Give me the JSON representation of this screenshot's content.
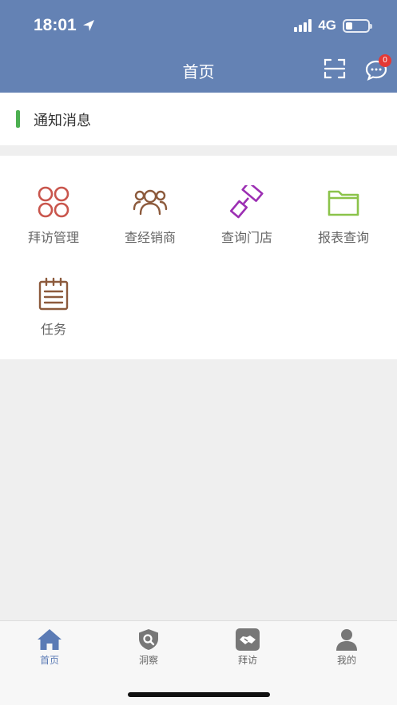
{
  "status_bar": {
    "time": "18:01",
    "network": "4G"
  },
  "header": {
    "title": "首页",
    "message_badge": "0"
  },
  "notice": {
    "label": "通知消息"
  },
  "menu": [
    {
      "label": "拜访管理",
      "icon": "four-circles-icon",
      "color": "#c9564d"
    },
    {
      "label": "查经销商",
      "icon": "people-group-icon",
      "color": "#8c5a3c"
    },
    {
      "label": "查询门店",
      "icon": "roller-brush-icon",
      "color": "#9c2fb3"
    },
    {
      "label": "报表查询",
      "icon": "folder-icon",
      "color": "#8bc34a"
    },
    {
      "label": "任务",
      "icon": "notepad-icon",
      "color": "#8c5a3c"
    }
  ],
  "tabs": [
    {
      "label": "首页",
      "icon": "home-icon",
      "active": true
    },
    {
      "label": "洞察",
      "icon": "shield-search-icon",
      "active": false
    },
    {
      "label": "拜访",
      "icon": "handshake-icon",
      "active": false
    },
    {
      "label": "我的",
      "icon": "user-icon",
      "active": false
    }
  ],
  "colors": {
    "header": "#6482b4",
    "tab_active": "#5b7bb5",
    "notice_bar": "#4caf50",
    "badge": "#e53935"
  }
}
